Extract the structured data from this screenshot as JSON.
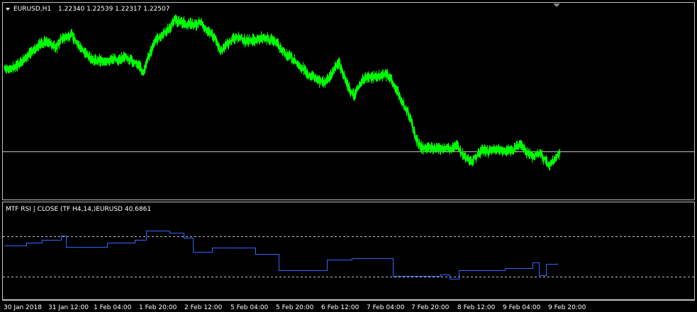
{
  "chart_data": [
    {
      "type": "candlestick",
      "symbol_label": "EURUSD,H1",
      "ohlc_readout": "1.22340 1.22539 1.22317 1.22507",
      "price_range": [
        1.2162,
        1.2533
      ],
      "horizontal_line_price": 1.2253,
      "colors": {
        "candle": "#00ff00",
        "grid_line": "#c0c0c0",
        "frame": "#c0c0c0",
        "background": "#000000"
      },
      "close_path": [
        1.242,
        1.2418,
        1.2425,
        1.2431,
        1.2441,
        1.2452,
        1.2462,
        1.2471,
        1.2475,
        1.247,
        1.2462,
        1.248,
        1.2484,
        1.2488,
        1.2474,
        1.2459,
        1.2448,
        1.2438,
        1.244,
        1.2432,
        1.2436,
        1.244,
        1.2437,
        1.2443,
        1.2441,
        1.2435,
        1.2429,
        1.2413,
        1.2444,
        1.247,
        1.2484,
        1.2492,
        1.25,
        1.252,
        1.2515,
        1.2512,
        1.251,
        1.2508,
        1.2514,
        1.2502,
        1.2492,
        1.2478,
        1.2455,
        1.2466,
        1.2478,
        1.2484,
        1.248,
        1.2475,
        1.2477,
        1.2479,
        1.2482,
        1.248,
        1.2478,
        1.2472,
        1.2457,
        1.2448,
        1.244,
        1.2428,
        1.2422,
        1.2408,
        1.2404,
        1.2395,
        1.2393,
        1.24,
        1.2418,
        1.2432,
        1.2405,
        1.2378,
        1.2365,
        1.239,
        1.2402,
        1.2403,
        1.2404,
        1.2406,
        1.241,
        1.2402,
        1.2378,
        1.236,
        1.234,
        1.2317,
        1.2278,
        1.2262,
        1.2258,
        1.2263,
        1.226,
        1.2257,
        1.2262,
        1.2257,
        1.2266,
        1.225,
        1.2236,
        1.2232,
        1.2245,
        1.2258,
        1.2252,
        1.2255,
        1.2258,
        1.2254,
        1.2256,
        1.2257,
        1.2268,
        1.226,
        1.2247,
        1.2242,
        1.2252,
        1.2236,
        1.2226,
        1.2236,
        1.2251
      ]
    },
    {
      "type": "line",
      "indicator_label": "MTF RSI | CLOSE  (TF H4,14,)EURUSD 40.6861",
      "value_range": [
        20,
        62
      ],
      "levels": [
        50,
        30
      ],
      "colors": {
        "series": "#3366ff",
        "level": "#c0c0c0"
      },
      "series": [
        {
          "x_frac": 0.0,
          "y": 45.5
        },
        {
          "x_frac": 0.04,
          "y": 47.0
        },
        {
          "x_frac": 0.068,
          "y": 48.5
        },
        {
          "x_frac": 0.102,
          "y": 50.5
        },
        {
          "x_frac": 0.112,
          "y": 45.0
        },
        {
          "x_frac": 0.186,
          "y": 46.8
        },
        {
          "x_frac": 0.236,
          "y": 48.2
        },
        {
          "x_frac": 0.257,
          "y": 53.0
        },
        {
          "x_frac": 0.299,
          "y": 51.8
        },
        {
          "x_frac": 0.324,
          "y": 49.5
        },
        {
          "x_frac": 0.341,
          "y": 42.5
        },
        {
          "x_frac": 0.375,
          "y": 44.5
        },
        {
          "x_frac": 0.454,
          "y": 41.5
        },
        {
          "x_frac": 0.496,
          "y": 33.2
        },
        {
          "x_frac": 0.574,
          "y": 33.2
        },
        {
          "x_frac": 0.583,
          "y": 38.5
        },
        {
          "x_frac": 0.628,
          "y": 39.3
        },
        {
          "x_frac": 0.702,
          "y": 30.5
        },
        {
          "x_frac": 0.788,
          "y": 31.3
        },
        {
          "x_frac": 0.805,
          "y": 29.0
        },
        {
          "x_frac": 0.822,
          "y": 33.2
        },
        {
          "x_frac": 0.905,
          "y": 34.2
        },
        {
          "x_frac": 0.955,
          "y": 37.0
        },
        {
          "x_frac": 0.967,
          "y": 31.0
        },
        {
          "x_frac": 0.98,
          "y": 36.5
        },
        {
          "x_frac": 1.0,
          "y": 36.8
        }
      ]
    }
  ],
  "x_axis": {
    "ticks": [
      "30 Jan 2018",
      "31 Jan 12:00",
      "1 Feb 04:00",
      "1 Feb 20:00",
      "2 Feb 12:00",
      "5 Feb 04:00",
      "5 Feb 20:00",
      "6 Feb 12:00",
      "7 Feb 04:00",
      "7 Feb 20:00",
      "8 Feb 12:00",
      "9 Feb 04:00",
      "9 Feb 20:00"
    ]
  },
  "header": {
    "dropdown_icon": "triangle-down-icon",
    "period_marker_icon": "triangle-down-marker-icon"
  }
}
